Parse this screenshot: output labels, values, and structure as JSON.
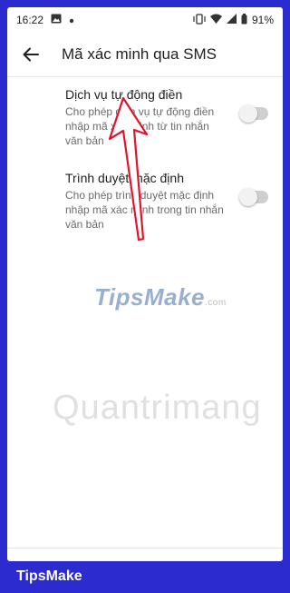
{
  "status": {
    "time": "16:22",
    "battery": "91%"
  },
  "appbar": {
    "title": "Mã xác minh qua SMS"
  },
  "settings": [
    {
      "title": "Dịch vụ tự động điền",
      "desc": "Cho phép dịch vụ tự động điền nhập mã xác minh từ tin nhắn văn bản",
      "enabled": false
    },
    {
      "title": "Trình duyệt mặc định",
      "desc": "Cho phép trình duyệt mặc định nhập mã xác minh trong tin nhắn văn bản",
      "enabled": false
    }
  ],
  "watermarks": {
    "tipsmake": "TipsMake",
    "tipsmake_suffix": ".com",
    "quantrimang": "Quantrimang"
  },
  "footer": {
    "brand": "TipsMake"
  },
  "colors": {
    "frame": "#2b2bcf",
    "arrow": "#e2142c"
  }
}
